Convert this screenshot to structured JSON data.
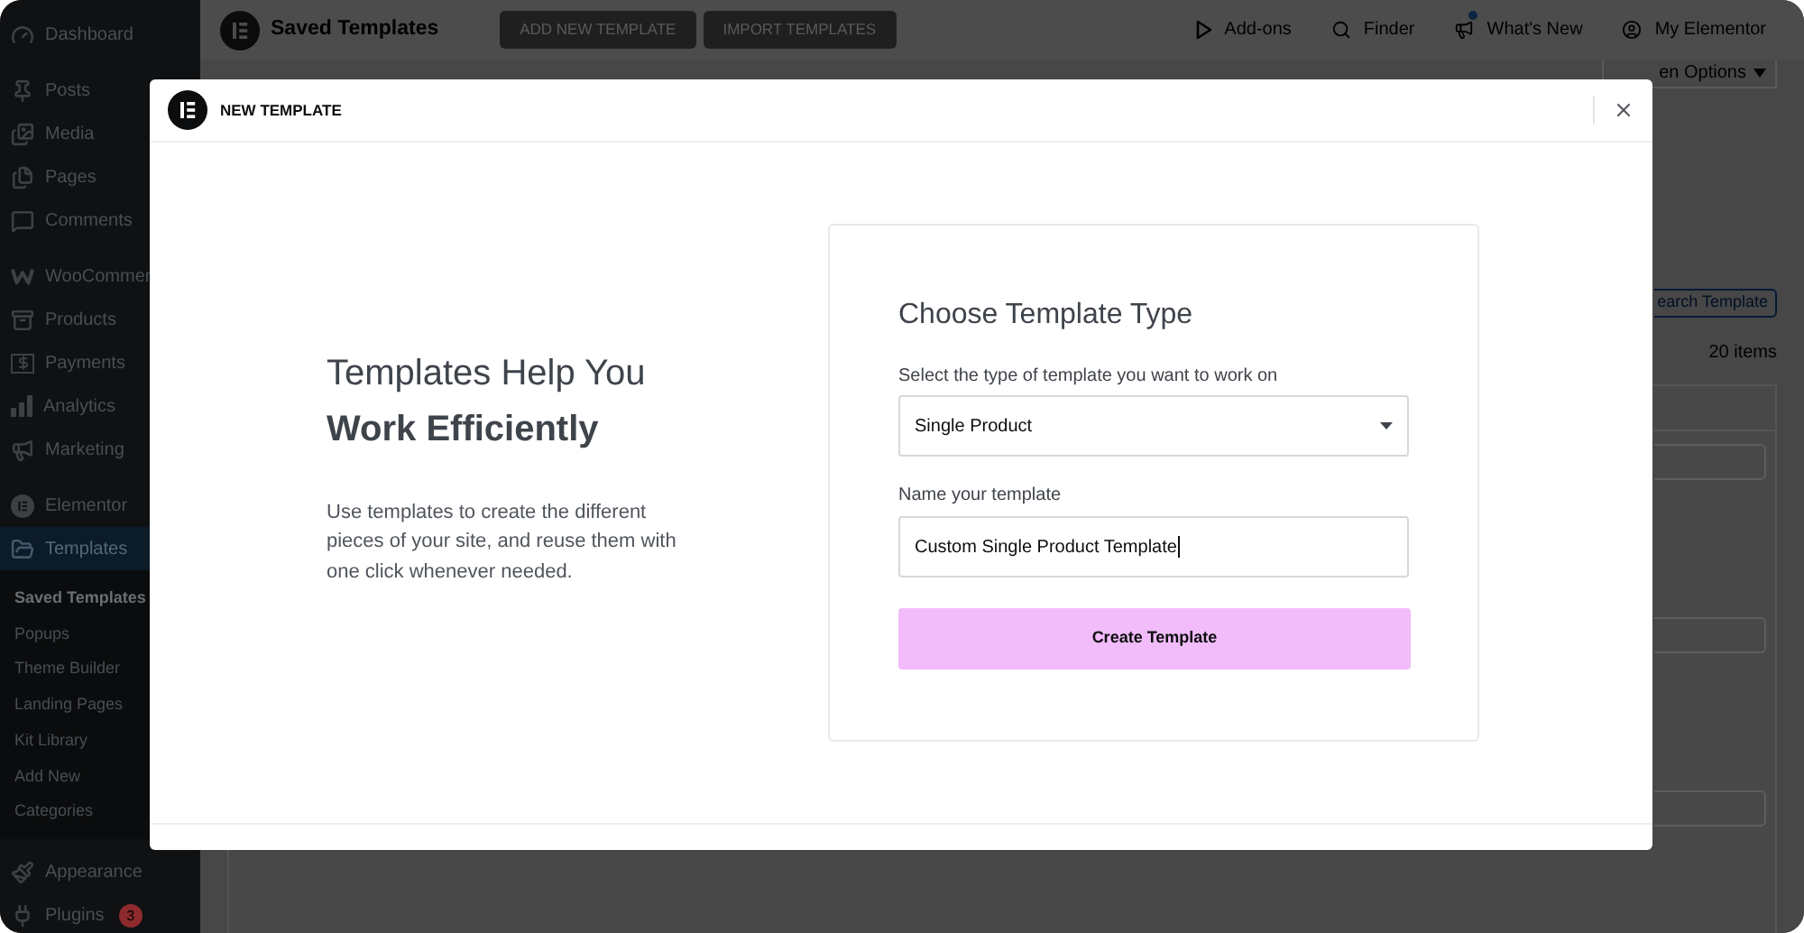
{
  "topbar": {
    "title": "Saved Templates",
    "buttons": [
      "ADD NEW TEMPLATE",
      "IMPORT TEMPLATES"
    ],
    "links": [
      {
        "label": "Add-ons",
        "notification": false
      },
      {
        "label": "Finder",
        "notification": false
      },
      {
        "label": "What's New",
        "notification": true
      },
      {
        "label": "My Elementor",
        "notification": false
      }
    ]
  },
  "sidebar": {
    "groups": [
      [
        {
          "label": "Dashboard",
          "selected": false
        }
      ],
      [
        {
          "label": "Posts",
          "selected": false
        },
        {
          "label": "Media",
          "selected": false
        },
        {
          "label": "Pages",
          "selected": false
        },
        {
          "label": "Comments",
          "selected": false
        }
      ],
      [
        {
          "label": "WooCommer",
          "selected": false
        },
        {
          "label": "Products",
          "selected": false
        },
        {
          "label": "Payments",
          "selected": false
        },
        {
          "label": "Analytics",
          "selected": false
        },
        {
          "label": "Marketing",
          "selected": false
        }
      ],
      [
        {
          "label": "Elementor",
          "selected": false
        },
        {
          "label": "Templates",
          "selected": true,
          "children": [
            {
              "label": "Saved Templates",
              "selected": true
            },
            {
              "label": "Popups",
              "selected": false
            },
            {
              "label": "Theme Builder",
              "selected": false
            },
            {
              "label": "Landing Pages",
              "selected": false
            },
            {
              "label": "Kit Library",
              "selected": false
            },
            {
              "label": "Add New",
              "selected": false
            },
            {
              "label": "Categories",
              "selected": false
            }
          ]
        }
      ],
      [
        {
          "label": "Appearance",
          "selected": false
        },
        {
          "label": "Plugins",
          "selected": false,
          "badge": "3"
        }
      ]
    ]
  },
  "page": {
    "screen_options": "en Options",
    "search_button": "earch Template",
    "items_count": "20 items"
  },
  "modal": {
    "title": "NEW TEMPLATE",
    "heading": [
      {
        "text": "Templates Help You",
        "bold": false
      },
      {
        "text": "Work Efficiently",
        "bold": true
      }
    ],
    "description": "Use templates to create the different pieces of your site, and reuse them with one click whenever needed.",
    "form": {
      "title": "Choose Template Type",
      "type_label": "Select the type of template you want to work on",
      "type_value": "Single Product",
      "name_label": "Name your template",
      "name_value": "Custom Single Product Template",
      "submit": "Create Template"
    }
  }
}
